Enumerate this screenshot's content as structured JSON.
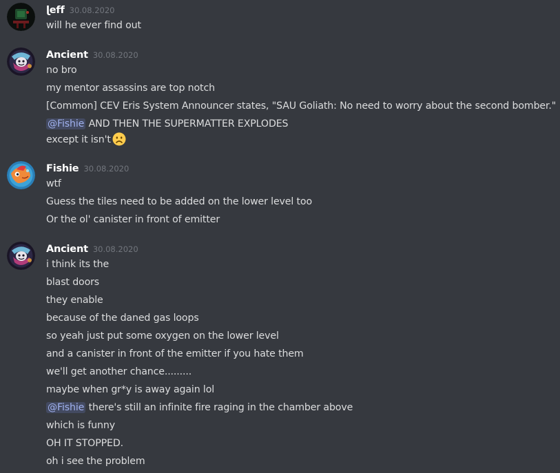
{
  "messages": [
    {
      "author": "ɭeff",
      "timestamp": "30.08.2020",
      "lines": [
        {
          "text": "will he ever find out"
        }
      ]
    },
    {
      "author": "Ancient",
      "timestamp": "30.08.2020",
      "lines": [
        {
          "text": "no bro"
        },
        {
          "text": "my mentor assassins are top notch"
        },
        {
          "text": "[Common] CEV Eris System Announcer states, \"SAU Goliath: No need to worry about the second bomber.\""
        },
        {
          "mention": "@Fishie",
          "text": " AND THEN THE SUPERMATTER EXPLODES"
        },
        {
          "text": "except it isn't",
          "emoji": "frowning-face"
        }
      ]
    },
    {
      "author": "Fishie",
      "timestamp": "30.08.2020",
      "lines": [
        {
          "text": "wtf"
        },
        {
          "text": "Guess the tiles need to be added on the lower level too"
        },
        {
          "text": "Or the ol' canister in front of emitter"
        }
      ]
    },
    {
      "author": "Ancient",
      "timestamp": "30.08.2020",
      "lines": [
        {
          "text": "i think its the"
        },
        {
          "text": "blast doors"
        },
        {
          "text": "they enable"
        },
        {
          "text": "because of the daned gas loops"
        },
        {
          "text": "so yeah just put some oxygen on the lower level"
        },
        {
          "text": "and a canister in front of the emitter if you hate them"
        },
        {
          "text": "we'll get another chance........."
        },
        {
          "text": "maybe when gr*y is away again lol"
        },
        {
          "mention": "@Fishie",
          "text": " there's still an infinite fire raging in the chamber above"
        },
        {
          "text": "which is funny"
        },
        {
          "text": "OH IT STOPPED."
        },
        {
          "text": "oh i see the problem"
        }
      ]
    }
  ],
  "colors": {
    "background": "#36393f",
    "username": "#ffffff",
    "timestamp": "#72767d",
    "text": "#dcddde",
    "mention_text": "#a0b1ee",
    "emoji_face": "#ffcc4d"
  }
}
